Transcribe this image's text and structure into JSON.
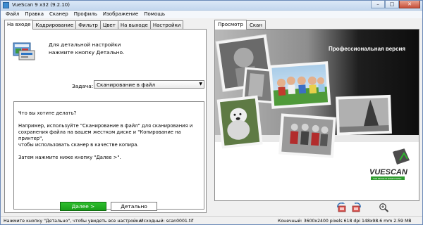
{
  "window": {
    "title": "VueScan 9 x32 (9.2.10)",
    "buttons": {
      "minimize": "–",
      "maximize": "□",
      "close": "✕"
    }
  },
  "menu": [
    "Файл",
    "Правка",
    "Сканер",
    "Профиль",
    "Изображение",
    "Помощь"
  ],
  "left_tabs": [
    "На входе",
    "Кадрирование",
    "Фильтр",
    "Цвет",
    "На выходе",
    "Настройки"
  ],
  "info": {
    "line1": "Для детальной настройки",
    "line2": "нажмите кнопку Детально."
  },
  "task": {
    "label": "Задача:",
    "value": "Сканирование в файл"
  },
  "help": {
    "p1": "Что вы хотите делать?",
    "p2a": "Например, используйте \"Сканирование в файл\" для сканирования и",
    "p2b": "сохранения файла на вашем жестком диске и \"Копирование на принтер\",",
    "p2c": "чтобы использовать сканер в качестве копира.",
    "p3": "Затем нажмите ниже кнопку \"Далее >\"."
  },
  "buttons": {
    "next": "Далее >",
    "detail": "Детально"
  },
  "right_tabs": [
    "Просмотр",
    "Скан"
  ],
  "preview": {
    "banner": "Профессиональная версия",
    "logo": "VUESCAN",
    "tagline": "THE IMAGE IS EVERYTHING"
  },
  "status": {
    "hint": "Нажмите кнопку \"Детально\", чтобы увидеть все настройки",
    "source": "Исходный: scan0001.tif",
    "final": "Конечный: 3600x2400 pixels 618 dpi 148x98.6 mm 2.59 MB"
  }
}
